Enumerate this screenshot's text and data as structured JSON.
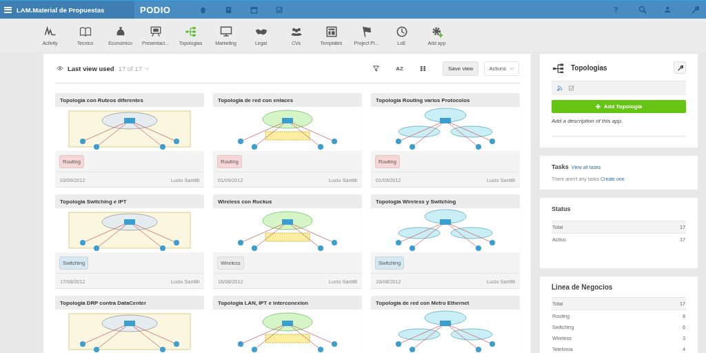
{
  "top_bar": {
    "workspace_title": "LAM.Material de Propuestas",
    "logo": "PODIO",
    "help_label": "?"
  },
  "apps": [
    {
      "label": "Activity",
      "selected": false
    },
    {
      "label": "Tecnico",
      "selected": false
    },
    {
      "label": "Economico",
      "selected": false
    },
    {
      "label": "Presentaci...",
      "selected": false
    },
    {
      "label": "Topologias",
      "selected": true
    },
    {
      "label": "Marketing",
      "selected": false
    },
    {
      "label": "Legal",
      "selected": false
    },
    {
      "label": "CVs",
      "selected": false
    },
    {
      "label": "Templates",
      "selected": false
    },
    {
      "label": "Project Pl...",
      "selected": false
    },
    {
      "label": "LoE",
      "selected": false
    },
    {
      "label": "Add app",
      "selected": false
    }
  ],
  "view_toolbar": {
    "view_name": "Last view used",
    "count": "17 of 17",
    "sort_label": "AZ",
    "save_button": "Save view",
    "actions_button": "Actions"
  },
  "cards": [
    {
      "title": "Topologia con Ruteos diferentes",
      "tag": {
        "label": "Routing",
        "color": "#f7d6d6"
      },
      "date": "03/09/2012",
      "author": "Lucio Santilli"
    },
    {
      "title": "Topologia de red con enlaces",
      "tag": {
        "label": "Routing",
        "color": "#f7d6d6"
      },
      "date": "01/09/2012",
      "author": "Lucio Santilli"
    },
    {
      "title": "Topologia Routing varios Protocolos",
      "tag": {
        "label": "Routing",
        "color": "#f7d6d6"
      },
      "date": "01/09/2012",
      "author": "Lucio Santilli"
    },
    {
      "title": "Topologia Switching e IPT",
      "tag": {
        "label": "Switching",
        "color": "#d6e8f2"
      },
      "date": "17/08/2012",
      "author": "Lucio Santilli"
    },
    {
      "title": "Wireless con Ruckus",
      "tag": {
        "label": "Wireless",
        "color": "#ececec"
      },
      "date": "16/08/2012",
      "author": "Lucio Santilli"
    },
    {
      "title": "Topologia Wireless y Switching",
      "tag": {
        "label": "Switching",
        "color": "#d6e8f2"
      },
      "date": "16/08/2012",
      "author": "Lucio Santilli"
    },
    {
      "title": "Topologia DRP contra DataCenter"
    },
    {
      "title": "Topologia LAN, IPT e interconexion"
    },
    {
      "title": "Topologia de red con Metro Ethernet"
    }
  ],
  "app_panel": {
    "title": "Topologias",
    "add_button": "Add Topologia",
    "description": "Add a description of this app."
  },
  "tasks": {
    "title": "Tasks",
    "view_all_link": "View all tasks",
    "empty_text": "There aren't any tasks",
    "create_link": "Create one"
  },
  "status": {
    "title": "Status",
    "rows": [
      {
        "label": "Total",
        "count": "17",
        "kind": "total"
      },
      {
        "label": "Activo",
        "count": "17",
        "kind": "item"
      }
    ]
  },
  "linea_de_negocios": {
    "title": "Linea de Negocios",
    "rows": [
      {
        "label": "Total",
        "count": "17",
        "kind": "total"
      },
      {
        "label": "Routing",
        "count": "8",
        "kind": "item"
      },
      {
        "label": "Switching",
        "count": "6",
        "kind": "item"
      },
      {
        "label": "Wireless",
        "count": "3",
        "kind": "item"
      },
      {
        "label": "Telefonía",
        "count": "4",
        "kind": "item"
      }
    ]
  }
}
